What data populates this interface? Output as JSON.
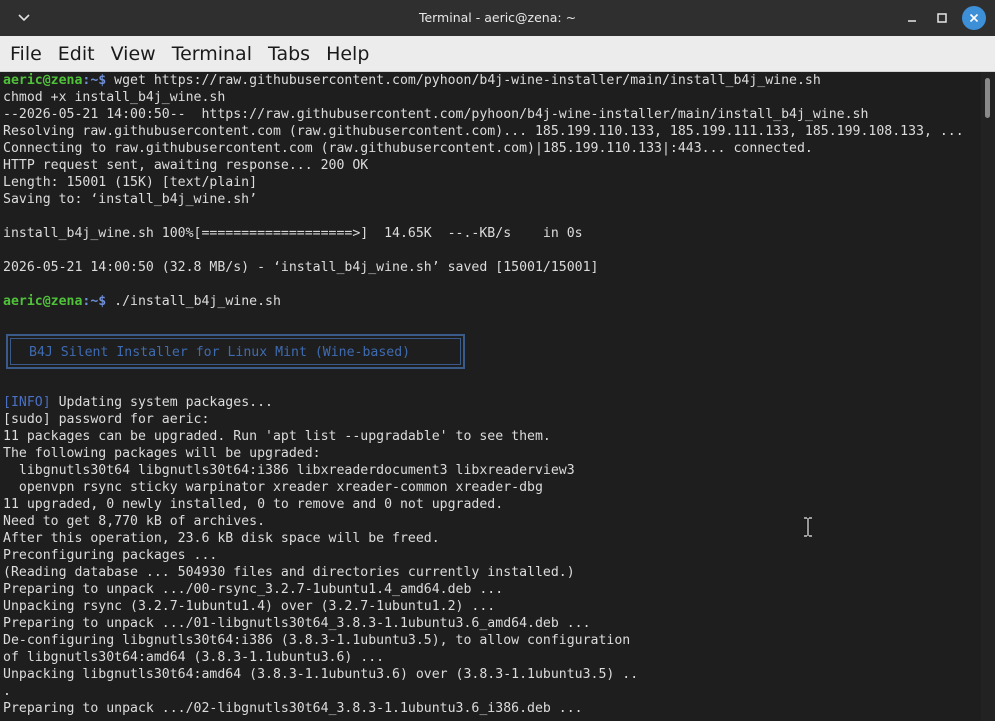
{
  "window": {
    "title": "Terminal - aeric@zena: ~"
  },
  "menu": [
    "File",
    "Edit",
    "View",
    "Terminal",
    "Tabs",
    "Help"
  ],
  "prompt": {
    "user": "aeric@zena",
    "path": ":~$"
  },
  "lines": [
    {
      "type": "prompt",
      "cmd": " wget https://raw.githubusercontent.com/pyhoon/b4j-wine-installer/main/install_b4j_wine.sh"
    },
    {
      "type": "text",
      "text": "chmod +x install_b4j_wine.sh"
    },
    {
      "type": "text",
      "text": "--2026-05-21 14:00:50--  https://raw.githubusercontent.com/pyhoon/b4j-wine-installer/main/install_b4j_wine.sh"
    },
    {
      "type": "text",
      "text": "Resolving raw.githubusercontent.com (raw.githubusercontent.com)... 185.199.110.133, 185.199.111.133, 185.199.108.133, ..."
    },
    {
      "type": "text",
      "text": "Connecting to raw.githubusercontent.com (raw.githubusercontent.com)|185.199.110.133|:443... connected."
    },
    {
      "type": "text",
      "text": "HTTP request sent, awaiting response... 200 OK"
    },
    {
      "type": "text",
      "text": "Length: 15001 (15K) [text/plain]"
    },
    {
      "type": "text",
      "text": "Saving to: ‘install_b4j_wine.sh’"
    },
    {
      "type": "text",
      "text": ""
    },
    {
      "type": "text",
      "text": "install_b4j_wine.sh 100%[===================>]  14.65K  --.-KB/s    in 0s"
    },
    {
      "type": "text",
      "text": ""
    },
    {
      "type": "text",
      "text": "2026-05-21 14:00:50 (32.8 MB/s) - ‘install_b4j_wine.sh’ saved [15001/15001]"
    },
    {
      "type": "text",
      "text": ""
    },
    {
      "type": "prompt",
      "cmd": " ./install_b4j_wine.sh"
    }
  ],
  "banner": "B4J Silent Installer for Linux Mint (Wine-based)",
  "output": [
    {
      "type": "info",
      "tag": "[INFO]",
      "text": " Updating system packages..."
    },
    {
      "type": "text",
      "text": "[sudo] password for aeric:"
    },
    {
      "type": "text",
      "text": "11 packages can be upgraded. Run 'apt list --upgradable' to see them."
    },
    {
      "type": "text",
      "text": "The following packages will be upgraded:"
    },
    {
      "type": "text",
      "text": "  libgnutls30t64 libgnutls30t64:i386 libxreaderdocument3 libxreaderview3"
    },
    {
      "type": "text",
      "text": "  openvpn rsync sticky warpinator xreader xreader-common xreader-dbg"
    },
    {
      "type": "text",
      "text": "11 upgraded, 0 newly installed, 0 to remove and 0 not upgraded."
    },
    {
      "type": "text",
      "text": "Need to get 8,770 kB of archives."
    },
    {
      "type": "text",
      "text": "After this operation, 23.6 kB disk space will be freed."
    },
    {
      "type": "text",
      "text": "Preconfiguring packages ..."
    },
    {
      "type": "text",
      "text": "(Reading database ... 504930 files and directories currently installed.)"
    },
    {
      "type": "text",
      "text": "Preparing to unpack .../00-rsync_3.2.7-1ubuntu1.4_amd64.deb ..."
    },
    {
      "type": "text",
      "text": "Unpacking rsync (3.2.7-1ubuntu1.4) over (3.2.7-1ubuntu1.2) ..."
    },
    {
      "type": "text",
      "text": "Preparing to unpack .../01-libgnutls30t64_3.8.3-1.1ubuntu3.6_amd64.deb ..."
    },
    {
      "type": "text",
      "text": "De-configuring libgnutls30t64:i386 (3.8.3-1.1ubuntu3.5), to allow configuration"
    },
    {
      "type": "text",
      "text": "of libgnutls30t64:amd64 (3.8.3-1.1ubuntu3.6) ..."
    },
    {
      "type": "text",
      "text": "Unpacking libgnutls30t64:amd64 (3.8.3-1.1ubuntu3.6) over (3.8.3-1.1ubuntu3.5) .."
    },
    {
      "type": "text",
      "text": "."
    },
    {
      "type": "text",
      "text": "Preparing to unpack .../02-libgnutls30t64_3.8.3-1.1ubuntu3.6_i386.deb ..."
    }
  ]
}
